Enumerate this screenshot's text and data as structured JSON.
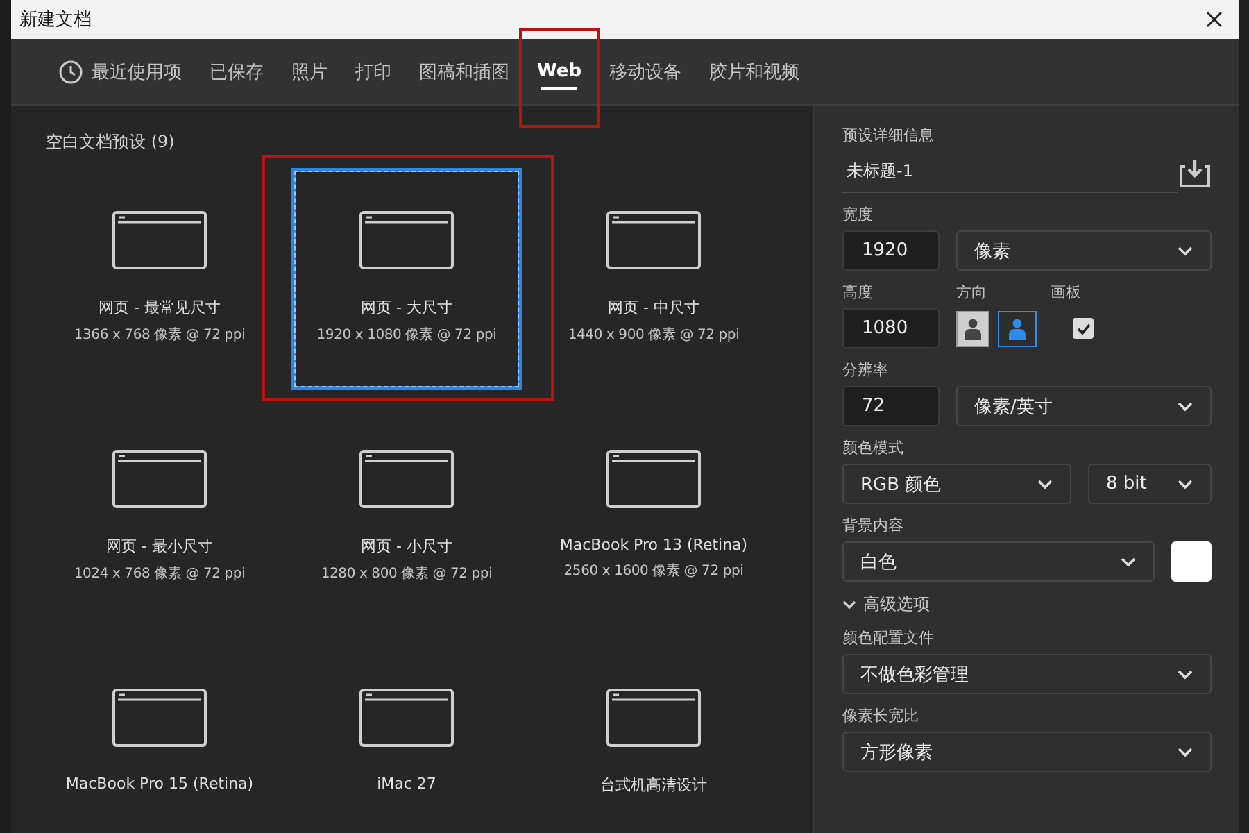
{
  "window": {
    "title": "新建文档"
  },
  "tabs": [
    {
      "label": "最近使用项",
      "kind": "history",
      "selected": false,
      "highlighted": false
    },
    {
      "label": "已保存",
      "kind": "plain",
      "selected": false,
      "highlighted": false
    },
    {
      "label": "照片",
      "kind": "plain",
      "selected": false,
      "highlighted": false
    },
    {
      "label": "打印",
      "kind": "plain",
      "selected": false,
      "highlighted": false
    },
    {
      "label": "图稿和插图",
      "kind": "plain",
      "selected": false,
      "highlighted": false
    },
    {
      "label": "Web",
      "kind": "plain",
      "selected": true,
      "highlighted": true
    },
    {
      "label": "移动设备",
      "kind": "plain",
      "selected": false,
      "highlighted": false
    },
    {
      "label": "胶片和视频",
      "kind": "plain",
      "selected": false,
      "highlighted": false
    }
  ],
  "presets": {
    "title": "空白文档预设 (9)",
    "items": [
      {
        "name": "网页 - 最常见尺寸",
        "size": "1366 x 768 像素 @ 72 ppi",
        "selected": false,
        "highlighted": false
      },
      {
        "name": "网页 - 大尺寸",
        "size": "1920 x 1080 像素 @ 72 ppi",
        "selected": true,
        "highlighted": true
      },
      {
        "name": "网页 - 中尺寸",
        "size": "1440 x 900 像素 @ 72 ppi",
        "selected": false,
        "highlighted": false
      },
      {
        "name": "网页 - 最小尺寸",
        "size": "1024 x 768 像素 @ 72 ppi",
        "selected": false,
        "highlighted": false
      },
      {
        "name": "网页 - 小尺寸",
        "size": "1280 x 800 像素 @ 72 ppi",
        "selected": false,
        "highlighted": false
      },
      {
        "name": "MacBook Pro 13 (Retina)",
        "size": "2560 x 1600 像素 @ 72 ppi",
        "selected": false,
        "highlighted": false
      },
      {
        "name": "MacBook Pro 15 (Retina)",
        "selected": false,
        "highlighted": false
      },
      {
        "name": "iMac 27",
        "selected": false,
        "highlighted": false
      },
      {
        "name": "台式机高清设计",
        "selected": false,
        "highlighted": false
      }
    ]
  },
  "details": {
    "title": "预设详细信息",
    "doc_name": "未标题-1",
    "width": {
      "label": "宽度",
      "value": "1920",
      "unit": "像素"
    },
    "height": {
      "label": "高度",
      "value": "1080"
    },
    "orientation": {
      "label": "方向",
      "options": [
        {
          "kind": "portrait",
          "selected": false
        },
        {
          "kind": "landscape",
          "selected": true
        }
      ]
    },
    "artboard": {
      "label": "画板",
      "checked": true
    },
    "resolution": {
      "label": "分辨率",
      "value": "72",
      "unit": "像素/英寸"
    },
    "color_mode": {
      "label": "颜色模式",
      "mode": "RGB 颜色",
      "depth": "8 bit"
    },
    "background": {
      "label": "背景内容",
      "value": "白色"
    },
    "advanced": {
      "label": "高级选项",
      "expanded": true
    },
    "color_profile": {
      "label": "颜色配置文件",
      "value": "不做色彩管理"
    },
    "pixel_aspect": {
      "label": "像素长宽比",
      "value": "方形像素"
    }
  }
}
